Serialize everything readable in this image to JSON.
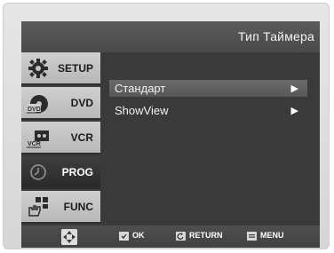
{
  "screen": {
    "title": "Тип Таймера"
  },
  "sidebar": {
    "items": [
      {
        "label": "SETUP",
        "icon": "gear-icon",
        "active": false
      },
      {
        "label": "DVD",
        "icon": "dvd-icon",
        "active": false
      },
      {
        "label": "VCR",
        "icon": "vcr-icon",
        "active": false
      },
      {
        "label": "PROG",
        "icon": "clock-icon",
        "active": true
      },
      {
        "label": "FUNC",
        "icon": "hand-remote-icon",
        "active": false
      }
    ]
  },
  "menu": {
    "items": [
      {
        "label": "Стандарт",
        "arrow": "▶",
        "selected": true
      },
      {
        "label": "ShowView",
        "arrow": "▶",
        "selected": false
      }
    ]
  },
  "bottom": {
    "nav_icon": "dpad-icon",
    "ok_label": "OK",
    "return_label": "RETURN",
    "menu_label": "MENU"
  }
}
